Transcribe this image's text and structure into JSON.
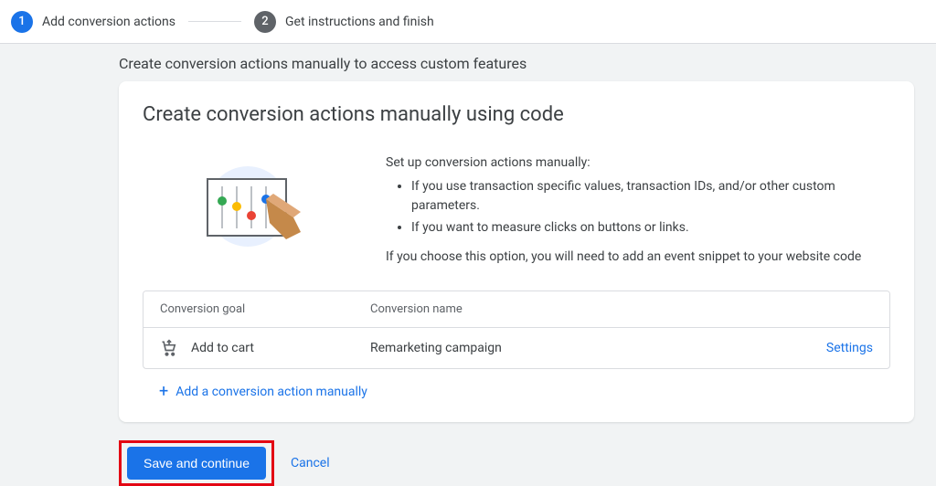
{
  "stepper": {
    "steps": [
      {
        "num": "1",
        "label": "Add conversion actions",
        "active": true
      },
      {
        "num": "2",
        "label": "Get instructions and finish",
        "active": false
      }
    ]
  },
  "page_subtitle": "Create conversion actions manually to access custom features",
  "card": {
    "title": "Create conversion actions manually using code",
    "desc_intro": "Set up conversion actions manually:",
    "bullets": [
      "If you use transaction specific values, transaction IDs, and/or other custom parameters.",
      "If you want to measure clicks on buttons or links."
    ],
    "desc_note": "If you choose this option, you will need to add an event snippet to your website code"
  },
  "table": {
    "headers": {
      "goal": "Conversion goal",
      "name": "Conversion name"
    },
    "row": {
      "goal": "Add to cart",
      "name": "Remarketing campaign",
      "settings": "Settings"
    }
  },
  "add_action_label": "Add a conversion action manually",
  "footer": {
    "save": "Save and continue",
    "cancel": "Cancel"
  }
}
